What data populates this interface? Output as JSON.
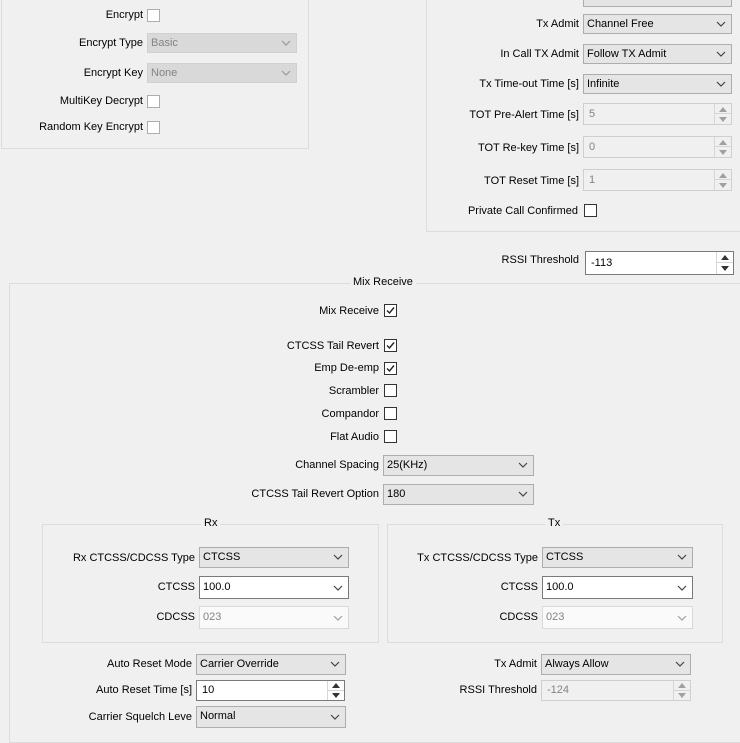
{
  "encryption": {
    "encrypt_label": "Encrypt",
    "encrypt_checked": false,
    "encrypt_type_label": "Encrypt Type",
    "encrypt_type_value": "Basic",
    "encrypt_key_label": "Encrypt Key",
    "encrypt_key_value": "None",
    "multikey_label": "MultiKey Decrypt",
    "multikey_checked": false,
    "random_key_label": "Random Key Encrypt",
    "random_key_checked": false
  },
  "tx": {
    "tx_admit_label": "Tx Admit",
    "tx_admit_value": "Channel Free",
    "in_call_label": "In Call TX Admit",
    "in_call_value": "Follow TX Admit",
    "timeout_label": "Tx Time-out Time [s]",
    "timeout_value": "Infinite",
    "tot_prealert_label": "TOT Pre-Alert Time [s]",
    "tot_prealert_value": "5",
    "tot_rekey_label": "TOT Re-key Time [s]",
    "tot_rekey_value": "0",
    "tot_reset_label": "TOT Reset Time [s]",
    "tot_reset_value": "1",
    "private_call_label": "Private Call Confirmed",
    "private_call_checked": false
  },
  "rssi": {
    "label": "RSSI Threshold",
    "value": "-113"
  },
  "mix_receive": {
    "group_title": "Mix Receive",
    "mix_receive_label": "Mix Receive",
    "mix_receive_checked": true,
    "ctcss_tail_revert_label": "CTCSS Tail Revert",
    "ctcss_tail_revert_checked": true,
    "emp_label": "Emp De-emp",
    "emp_checked": true,
    "scrambler_label": "Scrambler",
    "scrambler_checked": false,
    "compandor_label": "Compandor",
    "compandor_checked": false,
    "flat_audio_label": "Flat Audio",
    "flat_audio_checked": false,
    "channel_spacing_label": "Channel Spacing",
    "channel_spacing_value": "25(KHz)",
    "tail_revert_option_label": "CTCSS Tail Revert Option",
    "tail_revert_option_value": "180"
  },
  "rx_group": {
    "title": "Rx",
    "type_label": "Rx CTCSS/CDCSS Type",
    "type_value": "CTCSS",
    "ctcss_label": "CTCSS",
    "ctcss_value": "100.0",
    "cdcss_label": "CDCSS",
    "cdcss_value": "023"
  },
  "tx_group": {
    "title": "Tx",
    "type_label": "Tx CTCSS/CDCSS Type",
    "type_value": "CTCSS",
    "ctcss_label": "CTCSS",
    "ctcss_value": "100.0",
    "cdcss_label": "CDCSS",
    "cdcss_value": "023"
  },
  "bottom": {
    "auto_reset_mode_label": "Auto Reset Mode",
    "auto_reset_mode_value": "Carrier Override",
    "auto_reset_time_label": "Auto Reset Time [s]",
    "auto_reset_time_value": "10",
    "carrier_squelch_label": "Carrier Squelch Leve",
    "carrier_squelch_value": "Normal",
    "tx_admit_label": "Tx Admit",
    "tx_admit_value": "Always Allow",
    "rssi_label": "RSSI Threshold",
    "rssi_value": "-124"
  },
  "icons": {
    "check": "checkmark-icon",
    "dropdown": "chevron-down-icon",
    "spin_up": "spin-up-icon",
    "spin_down": "spin-down-icon"
  }
}
